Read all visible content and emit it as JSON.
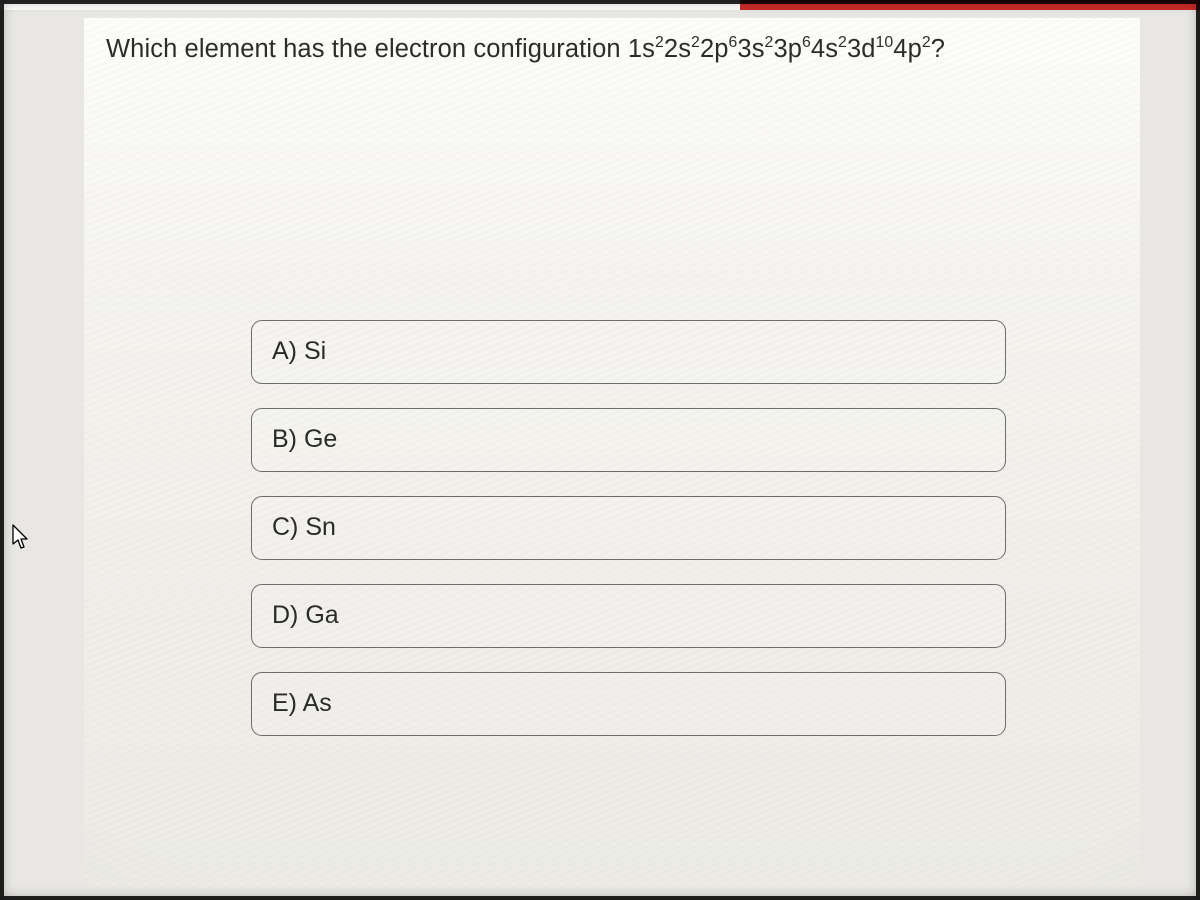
{
  "question": {
    "prefix": "Which element has the electron configuration ",
    "config_segments": [
      {
        "base": "1s",
        "sup": "2"
      },
      {
        "base": "2s",
        "sup": "2"
      },
      {
        "base": "2p",
        "sup": "6"
      },
      {
        "base": "3s",
        "sup": "2"
      },
      {
        "base": "3p",
        "sup": "6"
      },
      {
        "base": "4s",
        "sup": "2"
      },
      {
        "base": "3d",
        "sup": "10"
      },
      {
        "base": "4p",
        "sup": "2"
      }
    ],
    "suffix": "?"
  },
  "answers": [
    {
      "letter": "A)",
      "text": "Si"
    },
    {
      "letter": "B)",
      "text": "Ge"
    },
    {
      "letter": "C)",
      "text": "Sn"
    },
    {
      "letter": "D)",
      "text": "Ga"
    },
    {
      "letter": "E)",
      "text": "As"
    }
  ]
}
